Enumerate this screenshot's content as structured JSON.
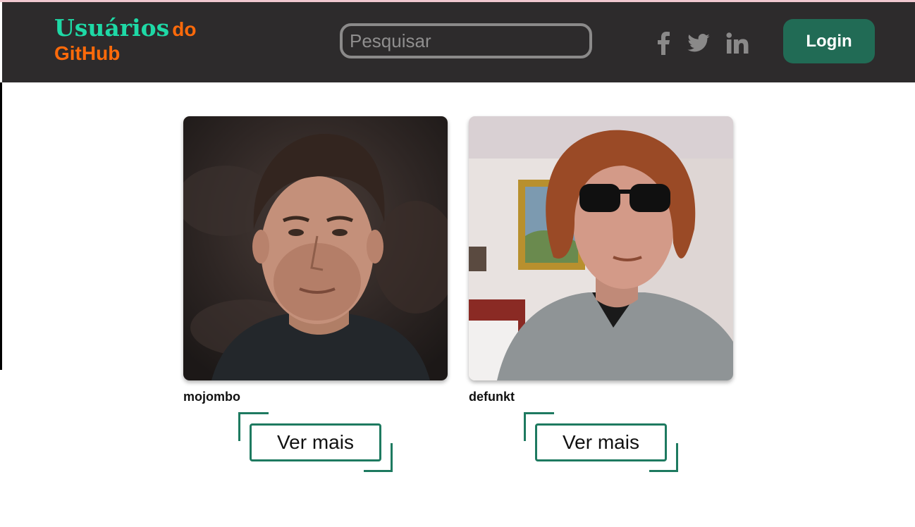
{
  "header": {
    "logo": {
      "word1": "Usuários",
      "word2": "do",
      "word3": "GitHub"
    },
    "search": {
      "placeholder": "Pesquisar",
      "value": ""
    },
    "social": [
      {
        "name": "facebook-icon"
      },
      {
        "name": "twitter-icon"
      },
      {
        "name": "linkedin-icon"
      }
    ],
    "login_label": "Login"
  },
  "users": [
    {
      "login": "mojombo",
      "more_label": "Ver mais"
    },
    {
      "login": "defunkt",
      "more_label": "Ver mais"
    }
  ],
  "colors": {
    "header_bg": "#2d2b2c",
    "logo_primary": "#1ed9a6",
    "logo_secondary": "#ff6a0a",
    "login_bg": "#216b55",
    "button_border": "#1e7a60"
  }
}
